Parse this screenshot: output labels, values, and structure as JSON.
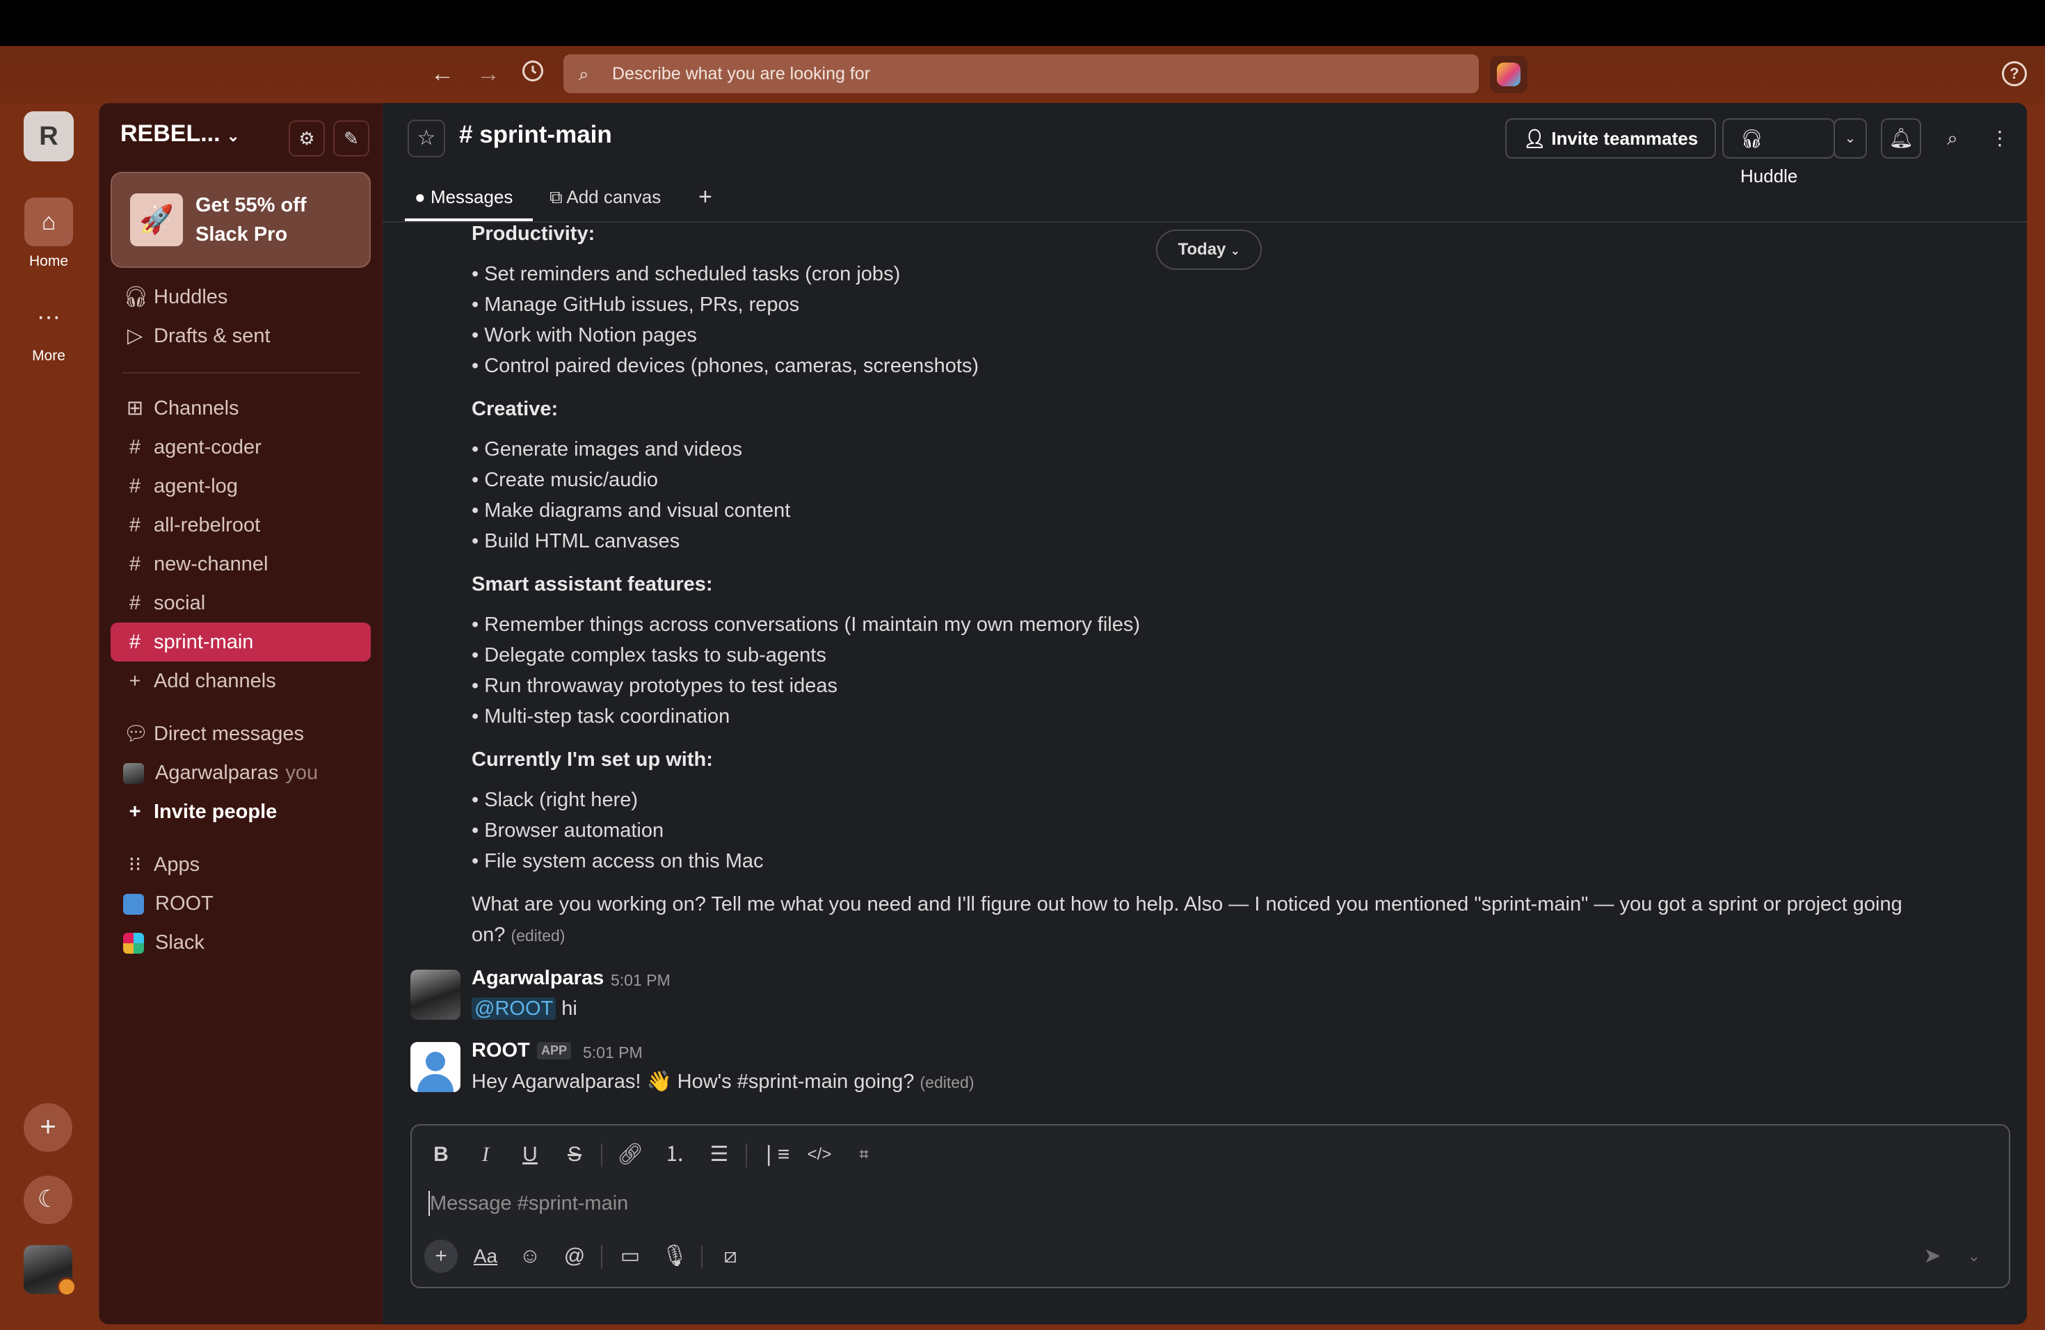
{
  "search": {
    "placeholder": "Describe what you are looking for"
  },
  "rail": {
    "workspace_initial": "R",
    "home_label": "Home",
    "more_label": "More"
  },
  "sidebar": {
    "workspace_name": "REBEL...",
    "promo": {
      "line1": "Get 55% off",
      "line2": "Slack Pro"
    },
    "huddles": "Huddles",
    "drafts": "Drafts & sent",
    "channels_header": "Channels",
    "channels": [
      "agent-coder",
      "agent-log",
      "all-rebelroot",
      "new-channel",
      "social",
      "sprint-main"
    ],
    "active_channel": "sprint-main",
    "add_channels": "Add channels",
    "dm_header": "Direct messages",
    "dm_user": "Agarwalparas",
    "dm_you": "you",
    "invite_people": "Invite people",
    "apps_header": "Apps",
    "apps": [
      "ROOT",
      "Slack"
    ]
  },
  "channel": {
    "title": "# sprint-main",
    "invite_button": "Invite teammates",
    "huddle_button": "Huddle",
    "tabs": {
      "messages": "Messages",
      "add_canvas": "Add canvas"
    },
    "today_pill": "Today"
  },
  "messages": {
    "productivity_header": "Productivity:",
    "productivity": [
      "• Set reminders and scheduled tasks (cron jobs)",
      "• Manage GitHub issues, PRs, repos",
      "• Work with Notion pages",
      "• Control paired devices (phones, cameras, screenshots)"
    ],
    "creative_header": "Creative:",
    "creative": [
      "• Generate images and videos",
      "• Create music/audio",
      "• Make diagrams and visual content",
      "• Build HTML canvases"
    ],
    "smart_header": "Smart assistant features:",
    "smart": [
      "• Remember things across conversations (I maintain my own memory files)",
      "• Delegate complex tasks to sub-agents",
      "• Run throwaway prototypes to test ideas",
      "• Multi-step task coordination"
    ],
    "setup_header": "Currently I'm set up with:",
    "setup": [
      "• Slack (right here)",
      "• Browser automation",
      "• File system access on this Mac"
    ],
    "closing_line1": "What are you working on? Tell me what you need and I'll figure out how to help. Also — I noticed you mentioned \"sprint-main\" — you got a sprint or project going",
    "closing_line2": "on?",
    "edited": "(edited)",
    "msg1": {
      "user": "Agarwalparas",
      "time": "5:01 PM",
      "mention": "@ROOT",
      "text": " hi"
    },
    "msg2": {
      "user": "ROOT",
      "badge": "APP",
      "time": "5:01 PM",
      "text": "Hey Agarwalparas! 👋 How's #sprint-main going?",
      "edited": "(edited)"
    }
  },
  "composer": {
    "placeholder": "Message #sprint-main",
    "format_label": "Aa"
  },
  "colors": {
    "sidebar_active": "#c22a4b",
    "frame": "#7a2e14",
    "main_bg": "#1e1f22"
  }
}
